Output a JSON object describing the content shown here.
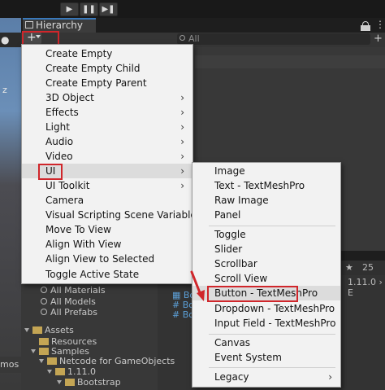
{
  "hierarchy": {
    "tab_label": "Hierarchy",
    "search_placeholder": "All"
  },
  "scene": {
    "axis_label": "z",
    "bottom_text": "mos"
  },
  "create_menu": {
    "items": [
      "Create Empty",
      "Create Empty Child",
      "Create Empty Parent",
      "3D Object",
      "Effects",
      "Light",
      "Audio",
      "Video",
      "UI",
      "UI Toolkit",
      "Camera",
      "Visual Scripting Scene Variables",
      "Move To View",
      "Align With View",
      "Align View to Selected",
      "Toggle Active State"
    ],
    "submenu_arrow": "›"
  },
  "ui_submenu": {
    "items": [
      "Image",
      "Text - TextMeshPro",
      "Raw Image",
      "Panel",
      "Toggle",
      "Slider",
      "Scrollbar",
      "Scroll View",
      "Button - TextMeshPro",
      "Dropdown - TextMeshPro",
      "Input Field - TextMeshPro",
      "Canvas",
      "Event System",
      "Legacy"
    ],
    "highlighted": "Button - TextMeshPro"
  },
  "project": {
    "tree": [
      "All Materials",
      "All Models",
      "All Prefabs",
      "Assets",
      "Resources",
      "Samples",
      "Netcode for GameObjects",
      "1.11.0",
      "Bootstrap"
    ],
    "files": [
      "Bo",
      "Bo",
      "Bo"
    ],
    "path_fragment": "1.11.0 › E",
    "count_badge": "25"
  },
  "colors": {
    "accent_red": "#d0262b",
    "menu_bg": "#f2f2f2",
    "editor_bg": "#383838"
  }
}
